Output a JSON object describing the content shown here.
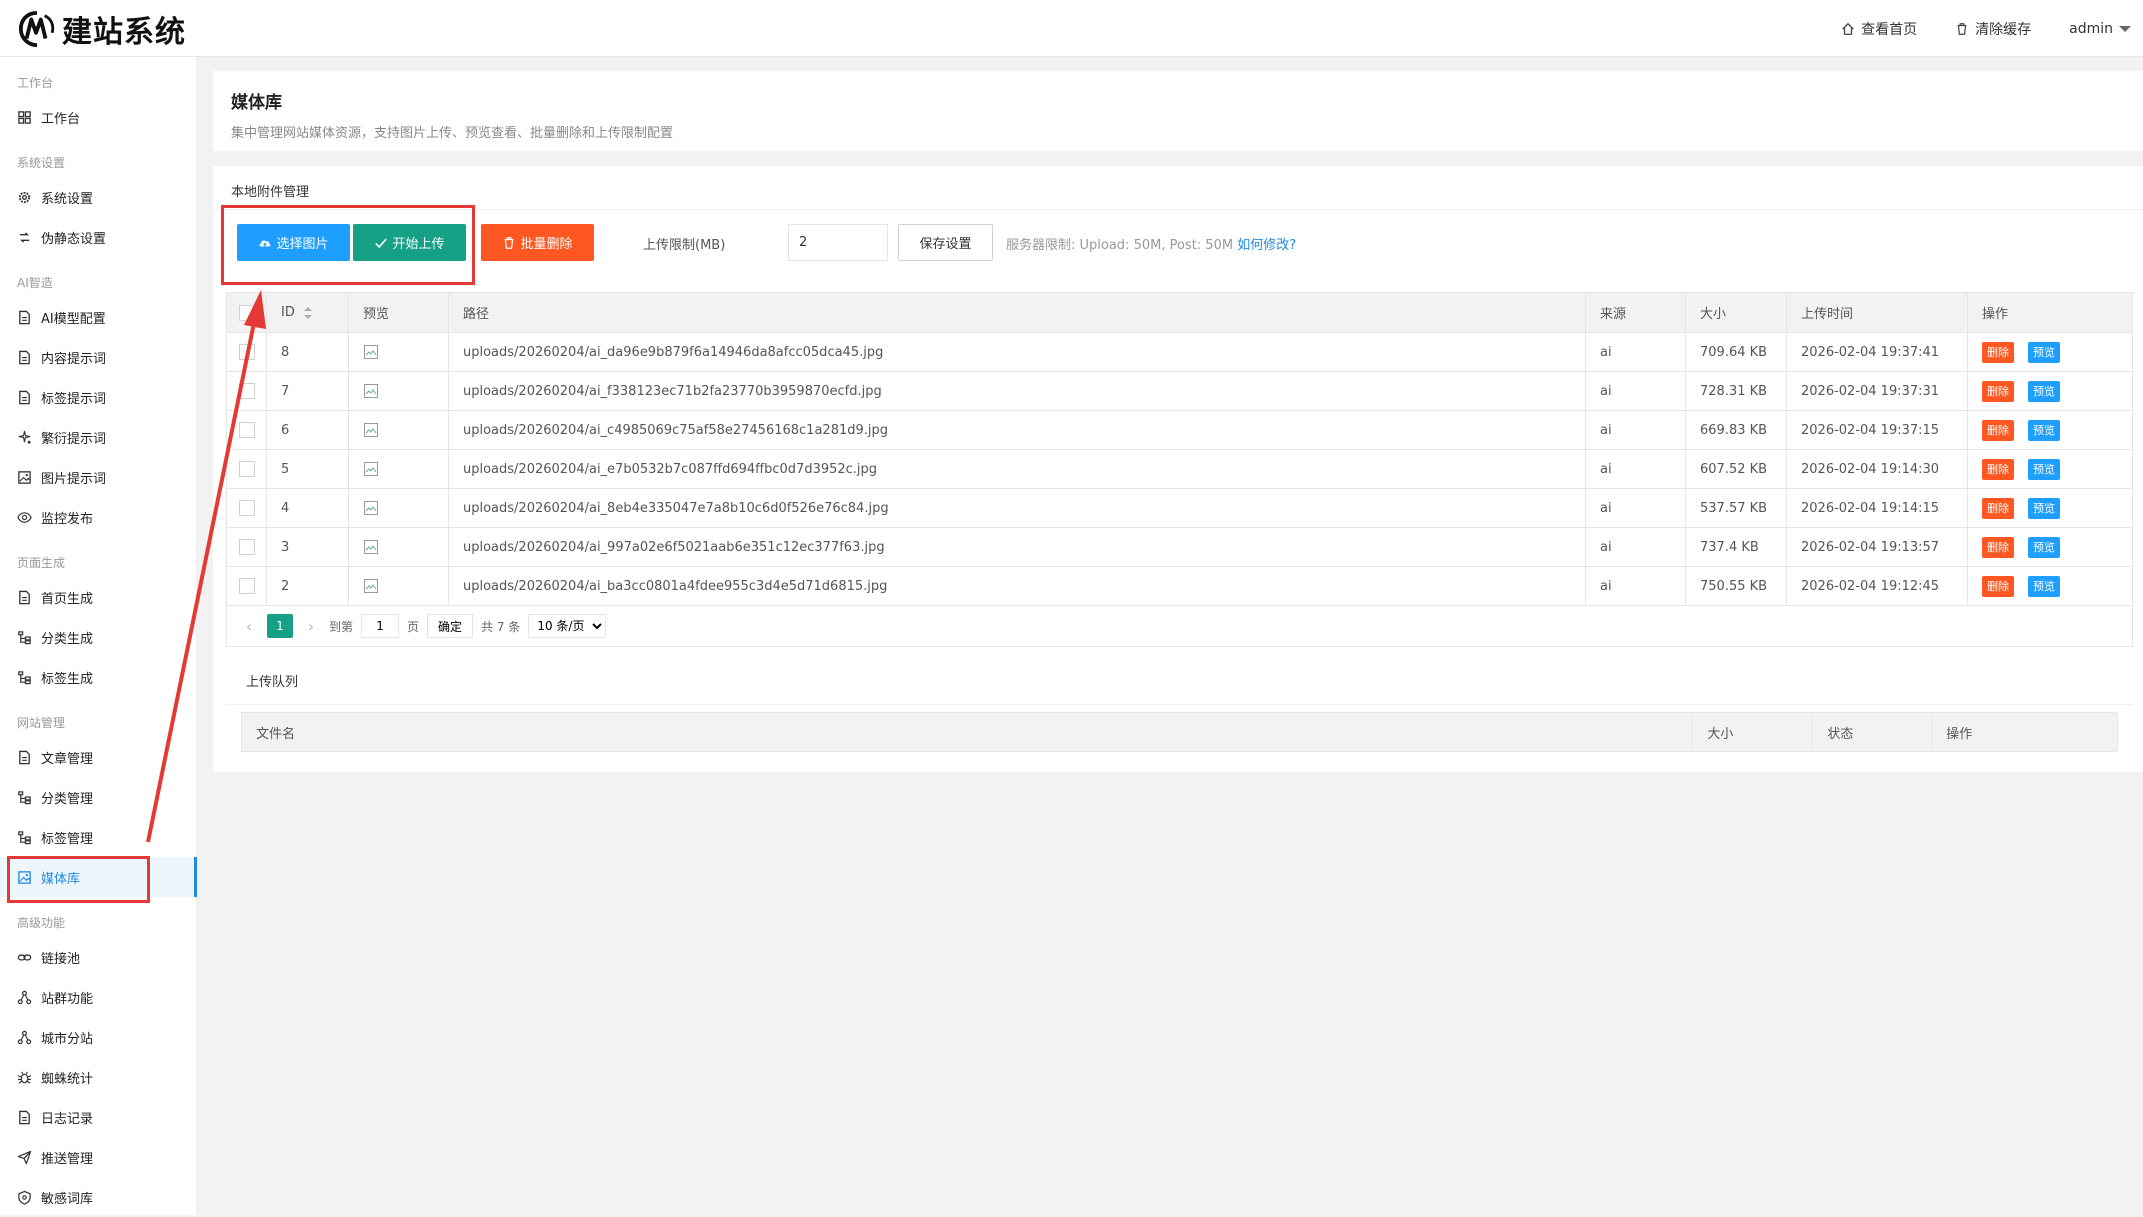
{
  "header": {
    "logo_text": "建站系统",
    "view_home": "查看首页",
    "clear_cache": "清除缓存",
    "user": "admin"
  },
  "sidebar": {
    "groups": {
      "workbench": "工作台",
      "system": "系统设置",
      "ai": "AI智造",
      "pagegen": "页面生成",
      "site": "网站管理",
      "advanced": "高级功能"
    },
    "items": [
      {
        "label": "工作台",
        "icon": "dashboard-icon"
      },
      {
        "label": "系统设置",
        "icon": "gear-icon"
      },
      {
        "label": "伪静态设置",
        "icon": "link-icon"
      },
      {
        "label": "AI模型配置",
        "icon": "document-icon"
      },
      {
        "label": "内容提示词",
        "icon": "document-icon"
      },
      {
        "label": "标签提示词",
        "icon": "document-icon"
      },
      {
        "label": "繁衍提示词",
        "icon": "sparkle-icon"
      },
      {
        "label": "图片提示词",
        "icon": "image-icon"
      },
      {
        "label": "监控发布",
        "icon": "eye-icon"
      },
      {
        "label": "首页生成",
        "icon": "document-icon"
      },
      {
        "label": "分类生成",
        "icon": "tree-icon"
      },
      {
        "label": "标签生成",
        "icon": "tree-icon"
      },
      {
        "label": "文章管理",
        "icon": "document-icon"
      },
      {
        "label": "分类管理",
        "icon": "tree-icon"
      },
      {
        "label": "标签管理",
        "icon": "tree-icon"
      },
      {
        "label": "媒体库",
        "icon": "image-icon"
      },
      {
        "label": "链接池",
        "icon": "chain-icon"
      },
      {
        "label": "站群功能",
        "icon": "network-icon"
      },
      {
        "label": "城市分站",
        "icon": "network-icon"
      },
      {
        "label": "蜘蛛统计",
        "icon": "bug-icon"
      },
      {
        "label": "日志记录",
        "icon": "document-icon"
      },
      {
        "label": "推送管理",
        "icon": "send-icon"
      },
      {
        "label": "敏感词库",
        "icon": "shield-icon"
      }
    ]
  },
  "page": {
    "title": "媒体库",
    "desc": "集中管理网站媒体资源，支持图片上传、预览查看、批量删除和上传限制配置"
  },
  "panel": {
    "title": "本地附件管理",
    "select_btn": "选择图片",
    "upload_btn": "开始上传",
    "batch_delete_btn": "批量删除",
    "limit_label": "上传限制(MB)",
    "limit_value": "2",
    "save_btn": "保存设置",
    "server_note": "服务器限制: Upload: 50M, Post: 50M",
    "how_link": "如何修改?"
  },
  "table": {
    "headers": {
      "id": "ID",
      "preview": "预览",
      "path": "路径",
      "source": "来源",
      "size": "大小",
      "time": "上传时间",
      "op": "操作"
    },
    "rows": [
      {
        "id": "8",
        "path": "uploads/20260204/ai_da96e9b879f6a14946da8afcc05dca45.jpg",
        "source": "ai",
        "size": "709.64 KB",
        "time": "2026-02-04 19:37:41"
      },
      {
        "id": "7",
        "path": "uploads/20260204/ai_f338123ec71b2fa23770b3959870ecfd.jpg",
        "source": "ai",
        "size": "728.31 KB",
        "time": "2026-02-04 19:37:31"
      },
      {
        "id": "6",
        "path": "uploads/20260204/ai_c4985069c75af58e27456168c1a281d9.jpg",
        "source": "ai",
        "size": "669.83 KB",
        "time": "2026-02-04 19:37:15"
      },
      {
        "id": "5",
        "path": "uploads/20260204/ai_e7b0532b7c087ffd694ffbc0d7d3952c.jpg",
        "source": "ai",
        "size": "607.52 KB",
        "time": "2026-02-04 19:14:30"
      },
      {
        "id": "4",
        "path": "uploads/20260204/ai_8eb4e335047e7a8b10c6d0f526e76c84.jpg",
        "source": "ai",
        "size": "537.57 KB",
        "time": "2026-02-04 19:14:15"
      },
      {
        "id": "3",
        "path": "uploads/20260204/ai_997a02e6f5021aab6e351c12ec377f63.jpg",
        "source": "ai",
        "size": "737.4 KB",
        "time": "2026-02-04 19:13:57"
      },
      {
        "id": "2",
        "path": "uploads/20260204/ai_ba3cc0801a4fdee955c3d4e5d71d6815.jpg",
        "source": "ai",
        "size": "750.55 KB",
        "time": "2026-02-04 19:12:45"
      }
    ],
    "delete_label": "删除",
    "preview_label": "预览"
  },
  "pagination": {
    "current": "1",
    "goto_label": "到第",
    "goto_value": "1",
    "page_label": "页",
    "confirm": "确定",
    "total": "共 7 条",
    "per_page": "10 条/页"
  },
  "queue": {
    "title": "上传队列",
    "headers": {
      "name": "文件名",
      "size": "大小",
      "status": "状态",
      "op": "操作"
    }
  },
  "colors": {
    "accent": "#1e9fff",
    "green": "#16a085",
    "orange": "#ff5722",
    "annotation": "#e53935"
  }
}
